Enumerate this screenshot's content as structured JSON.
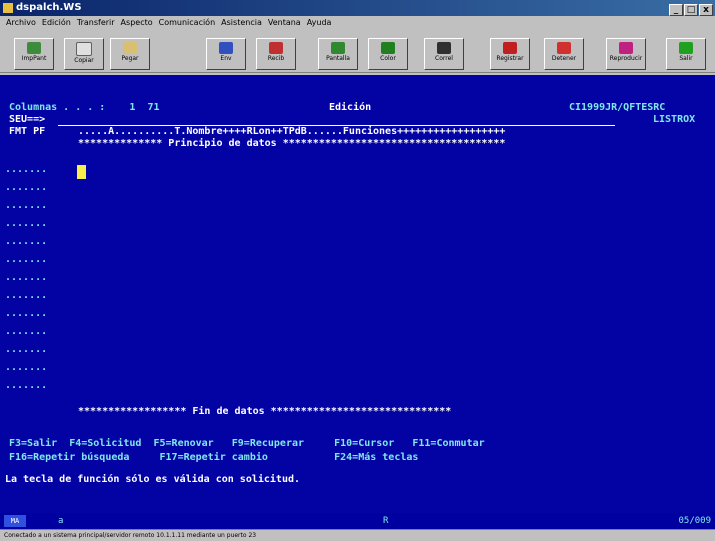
{
  "window": {
    "title": "dspalch.WS",
    "buttons": [
      "_",
      "□",
      "x"
    ]
  },
  "menu": [
    "Archivo",
    "Edición",
    "Transferir",
    "Aspecto",
    "Comunicación",
    "Asistencia",
    "Ventana",
    "Ayuda"
  ],
  "toolbar": [
    {
      "label": "ImpPant",
      "icon": "print-screen-icon",
      "color": "#3c8c3c"
    },
    {
      "label": "Copiar",
      "icon": "copy-icon",
      "color": "#e0e0e0"
    },
    {
      "label": "Pegar",
      "icon": "paste-icon",
      "color": "#d8c070"
    },
    {
      "label": "Env",
      "icon": "send-icon",
      "color": "#3050c0"
    },
    {
      "label": "Recib",
      "icon": "receive-icon",
      "color": "#c03030"
    },
    {
      "label": "Pantalla",
      "icon": "display-icon",
      "color": "#308830"
    },
    {
      "label": "Color",
      "icon": "color-icon",
      "color": "#208020"
    },
    {
      "label": "Correl",
      "icon": "correlate-icon",
      "color": "#303030"
    },
    {
      "label": "Registrar",
      "icon": "record-macro-icon",
      "color": "#c02020"
    },
    {
      "label": "Detener",
      "icon": "stop-icon",
      "color": "#d03030"
    },
    {
      "label": "Reproducir",
      "icon": "play-macro-icon",
      "color": "#c02080"
    },
    {
      "label": "Salir",
      "icon": "exit-icon",
      "color": "#20a020"
    }
  ],
  "screen": {
    "header_left": "Columnas . . . :    1  71",
    "header_center": "Edición",
    "header_right": "CI1999JR/QFTESRC",
    "seu_prompt": "SEU==>",
    "member": "LISTROX",
    "fmt": "FMT PF",
    "ruler": ".....A..........T.Nombre++++RLon++TPdB......Funciones++++++++++++++++++",
    "top_of_data": "************** Principio de datos *************************************",
    "line_prefix": ".......",
    "end_of_data": "****************** Fin de datos ******************************",
    "fkeys_line1": "F3=Salir  F4=Solicitud  F5=Renovar   F9=Recuperar     F10=Cursor   F11=Conmutar",
    "fkeys_line2": "F16=Repetir búsqueda     F17=Repetir cambio           F24=Más teclas",
    "message": "La tecla de función sólo es válida con solicitud."
  },
  "oia": {
    "mode": "MA",
    "session": "a",
    "indicator": "R",
    "cursor_pos": "05/009"
  },
  "status": "Conectado a un sistema principal/servidor remoto 10.1.1.11 mediante un puerto 23"
}
